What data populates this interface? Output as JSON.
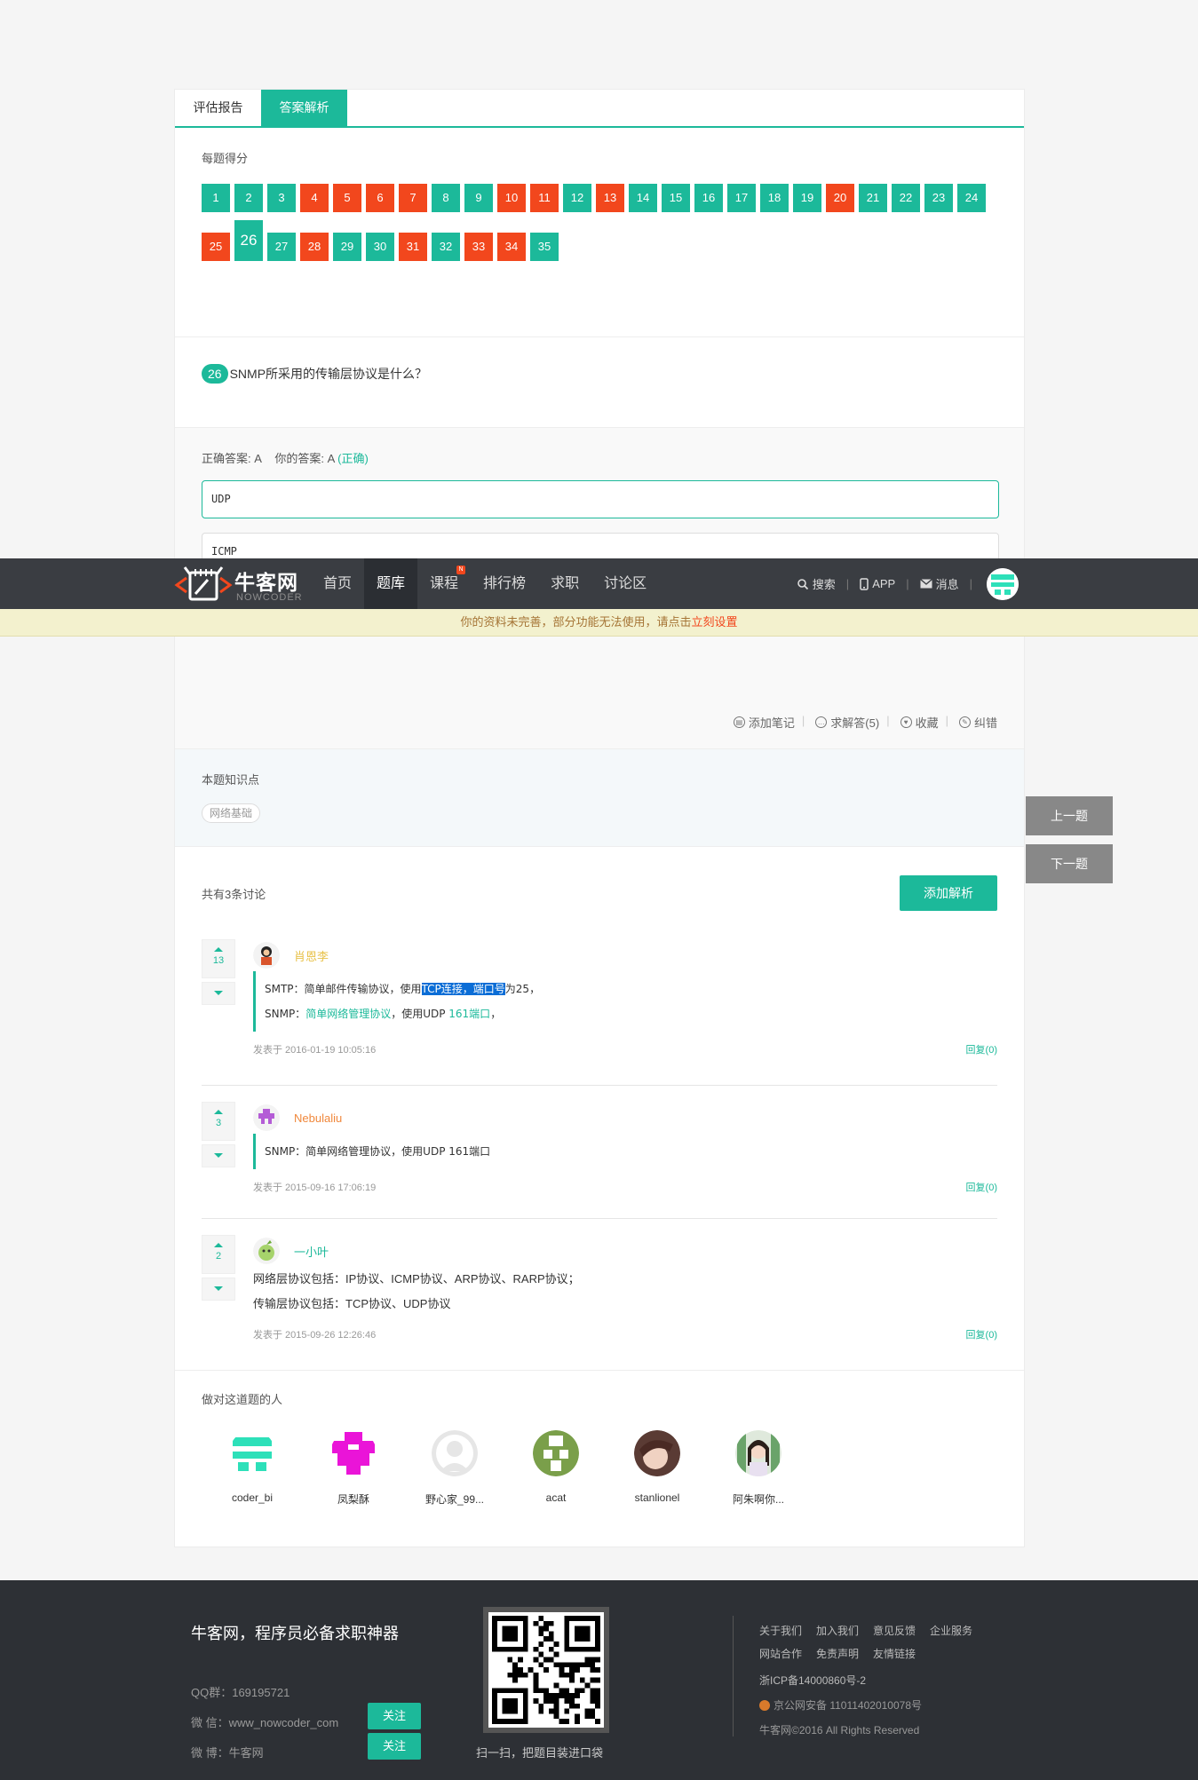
{
  "tabs": [
    "评估报告",
    "答案解析"
  ],
  "scores": {
    "label": "每题得分",
    "items": [
      {
        "n": "1",
        "s": "ok"
      },
      {
        "n": "2",
        "s": "ok"
      },
      {
        "n": "3",
        "s": "ok"
      },
      {
        "n": "4",
        "s": "bad"
      },
      {
        "n": "5",
        "s": "bad"
      },
      {
        "n": "6",
        "s": "bad"
      },
      {
        "n": "7",
        "s": "bad"
      },
      {
        "n": "8",
        "s": "ok"
      },
      {
        "n": "9",
        "s": "ok"
      },
      {
        "n": "10",
        "s": "bad"
      },
      {
        "n": "11",
        "s": "bad"
      },
      {
        "n": "12",
        "s": "ok"
      },
      {
        "n": "13",
        "s": "bad"
      },
      {
        "n": "14",
        "s": "ok"
      },
      {
        "n": "15",
        "s": "ok"
      },
      {
        "n": "16",
        "s": "ok"
      },
      {
        "n": "17",
        "s": "ok"
      },
      {
        "n": "18",
        "s": "ok"
      },
      {
        "n": "19",
        "s": "ok"
      },
      {
        "n": "20",
        "s": "bad"
      },
      {
        "n": "21",
        "s": "ok"
      },
      {
        "n": "22",
        "s": "ok"
      },
      {
        "n": "23",
        "s": "ok"
      },
      {
        "n": "24",
        "s": "ok"
      },
      {
        "n": "25",
        "s": "bad"
      },
      {
        "n": "26",
        "s": "ok",
        "current": true
      },
      {
        "n": "27",
        "s": "ok"
      },
      {
        "n": "28",
        "s": "bad"
      },
      {
        "n": "29",
        "s": "ok"
      },
      {
        "n": "30",
        "s": "ok"
      },
      {
        "n": "31",
        "s": "bad"
      },
      {
        "n": "32",
        "s": "ok"
      },
      {
        "n": "33",
        "s": "bad"
      },
      {
        "n": "34",
        "s": "bad"
      },
      {
        "n": "35",
        "s": "ok"
      }
    ]
  },
  "question": {
    "num": "26",
    "text": "SNMP所采用的传输层协议是什么？"
  },
  "answer": {
    "correct_label": "正确答案: A",
    "yours_label": "你的答案: A",
    "result": "(正确)",
    "options": [
      "UDP",
      "ICMP"
    ]
  },
  "tools": [
    "添加笔记",
    "求解答(5)",
    "收藏",
    "纠错"
  ],
  "knowledge": {
    "label": "本题知识点",
    "tag": "网络基础"
  },
  "discuss": {
    "count": "共有3条讨论",
    "add": "添加解析",
    "comments": [
      {
        "votes": "13",
        "user": "肖恩李",
        "user_color": "#e8c24a",
        "l1_pre": "SMTP：简单邮件传输协议，使用",
        "l1_hl": "TCP连接，端口号",
        "l1_post": "为25，",
        "l2_pre": "SNMP：",
        "l2_link": "简单网络管理协议",
        "l2_post": "，使用UDP ",
        "l2_link2": "161端口",
        "l2_end": "，",
        "time": "发表于 2016-01-19 10:05:16",
        "reply": "回复(0)"
      },
      {
        "votes": "3",
        "user": "Nebulaliu",
        "user_color": "#f0883c",
        "text": "SNMP：简单网络管理协议，使用UDP 161端口",
        "time": "发表于 2015-09-16 17:06:19",
        "reply": "回复(0)"
      },
      {
        "votes": "2",
        "user": "一小叶",
        "user_color": "#1cb99a",
        "p1": "网络层协议包括：IP协议、ICMP协议、ARP协议、RARP协议；",
        "p2": "传输层协议包括：TCP协议、UDP协议",
        "time": "发表于 2015-09-26 12:26:46",
        "reply": "回复(0)"
      }
    ]
  },
  "people": {
    "label": "做对这道题的人",
    "list": [
      "coder_bi",
      "凤梨酥",
      "野心家_99...",
      "acat",
      "stanlionel",
      "阿朱啊你..."
    ]
  },
  "side": {
    "prev": "上一题",
    "next": "下一题"
  },
  "nav": {
    "logo": "牛客网",
    "logo_sub": "NOWCODER",
    "items": [
      "首页",
      "题库",
      "课程",
      "排行榜",
      "求职",
      "讨论区"
    ],
    "badge": "N",
    "search": "搜索",
    "app": "APP",
    "msg": "消息"
  },
  "notice": {
    "text": "你的资料未完善，部分功能无法使用，请点击",
    "link": "立刻设置"
  },
  "footer": {
    "title": "牛客网，程序员必备求职神器",
    "qq": "QQ群：169195721",
    "wechat": "微 信：www_nowcoder_com",
    "weibo": "微 博：牛客网",
    "follow": "关注",
    "qr_caption": "扫一扫，把题目装进口袋",
    "links1": [
      "关于我们",
      "加入我们",
      "意见反馈",
      "企业服务"
    ],
    "links2": [
      "网站合作",
      "免责声明",
      "友情链接"
    ],
    "icp": "浙ICP备14000860号-2",
    "police": "京公网安备 11011402010078号",
    "copy": "牛客网©2016 All Rights Reserved"
  },
  "colors": {
    "accent": "#1cb99a",
    "wrong": "#f2471d",
    "nav": "#3a3d42",
    "footer": "#2d3035"
  }
}
